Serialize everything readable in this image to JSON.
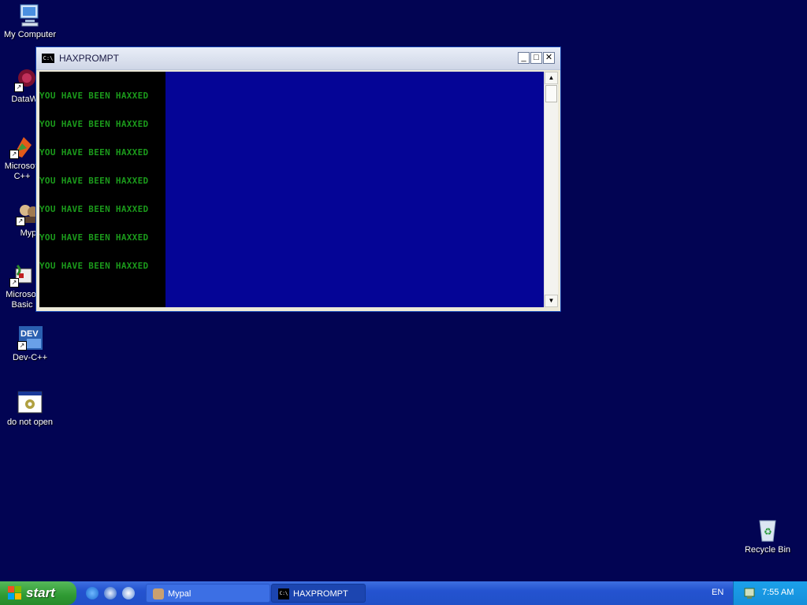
{
  "desktop": {
    "icons": [
      {
        "label": "My Computer",
        "name": "my-computer-icon"
      },
      {
        "label": "DataWa",
        "name": "datawave-shortcut-icon"
      },
      {
        "label": "Microsoft\nC++",
        "name": "microsoft-cpp-shortcut-icon"
      },
      {
        "label": "Myp",
        "name": "mypal-shortcut-icon"
      },
      {
        "label": "Microsof\nBasic",
        "name": "microsoft-basic-shortcut-icon"
      },
      {
        "label": "Dev-C++",
        "name": "dev-cpp-shortcut-icon"
      },
      {
        "label": "do not open",
        "name": "do-not-open-icon"
      },
      {
        "label": "Recycle Bin",
        "name": "recycle-bin-icon"
      }
    ]
  },
  "window": {
    "title": "HAXPROMPT",
    "icon_text": "C:\\",
    "minimize_glyph": "_",
    "maximize_glyph": "□",
    "close_glyph": "✕",
    "console_lines": [
      "YOU HAVE BEEN HAXXED",
      "YOU HAVE BEEN HAXXED",
      "YOU HAVE BEEN HAXXED",
      "YOU HAVE BEEN HAXXED",
      "YOU HAVE BEEN HAXXED",
      "YOU HAVE BEEN HAXXED",
      "YOU HAVE BEEN HAXXED"
    ],
    "scroll_up_glyph": "▲",
    "scroll_down_glyph": "▼"
  },
  "taskbar": {
    "start_label": "start",
    "tasks": [
      {
        "label": "Mypal",
        "active": false
      },
      {
        "label": "HAXPROMPT",
        "active": true
      }
    ],
    "language": "EN",
    "clock": "7:55 AM"
  },
  "colors": {
    "desktop_bg": "#020453",
    "console_text": "#1b9a1b",
    "console_blue": "#050596",
    "taskbar": "#2453d0",
    "start_green": "#2f9a33"
  }
}
